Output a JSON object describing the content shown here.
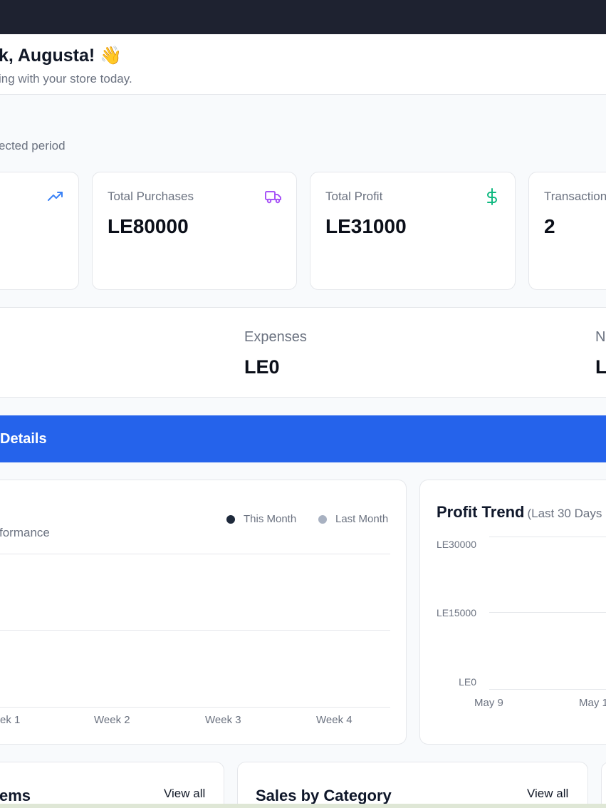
{
  "header": {
    "greeting": "k, Augusta! 👋",
    "subtitle": "ing with your store today."
  },
  "summary": {
    "period_note": "ected period"
  },
  "stat_cards": [
    {
      "label": "",
      "value": "",
      "icon": "trending-up-icon",
      "color": "#3b82f6"
    },
    {
      "label": "Total Purchases",
      "value": "LE80000",
      "icon": "truck-icon",
      "color": "#a855f7"
    },
    {
      "label": "Total Profit",
      "value": "LE31000",
      "icon": "dollar-icon",
      "color": "#10b981"
    },
    {
      "label": "Transaction",
      "value": "2"
    }
  ],
  "financials": [
    {
      "label": "Expenses",
      "value": "LE0"
    },
    {
      "label": "N",
      "value": "L"
    }
  ],
  "details_bar": {
    "title": "Details",
    "color": "#2563eb"
  },
  "performance": {
    "subtitle": "formance",
    "legend": [
      {
        "name": "This Month",
        "color": "#1e293b"
      },
      {
        "name": "Last Month",
        "color": "#a8b1c1"
      }
    ],
    "x_ticks": [
      "ek 1",
      "Week 2",
      "Week 3",
      "Week 4"
    ]
  },
  "profit_trend": {
    "title": "Profit Trend",
    "subtitle": "(Last 30 Days",
    "y_ticks": [
      "LE30000",
      "LE15000",
      "LE0"
    ],
    "x_ticks": [
      "May 9",
      "May 1"
    ]
  },
  "bottom_left": {
    "title": "ems",
    "link": "View all"
  },
  "bottom_right": {
    "title": "Sales by Category",
    "link": "View all"
  }
}
